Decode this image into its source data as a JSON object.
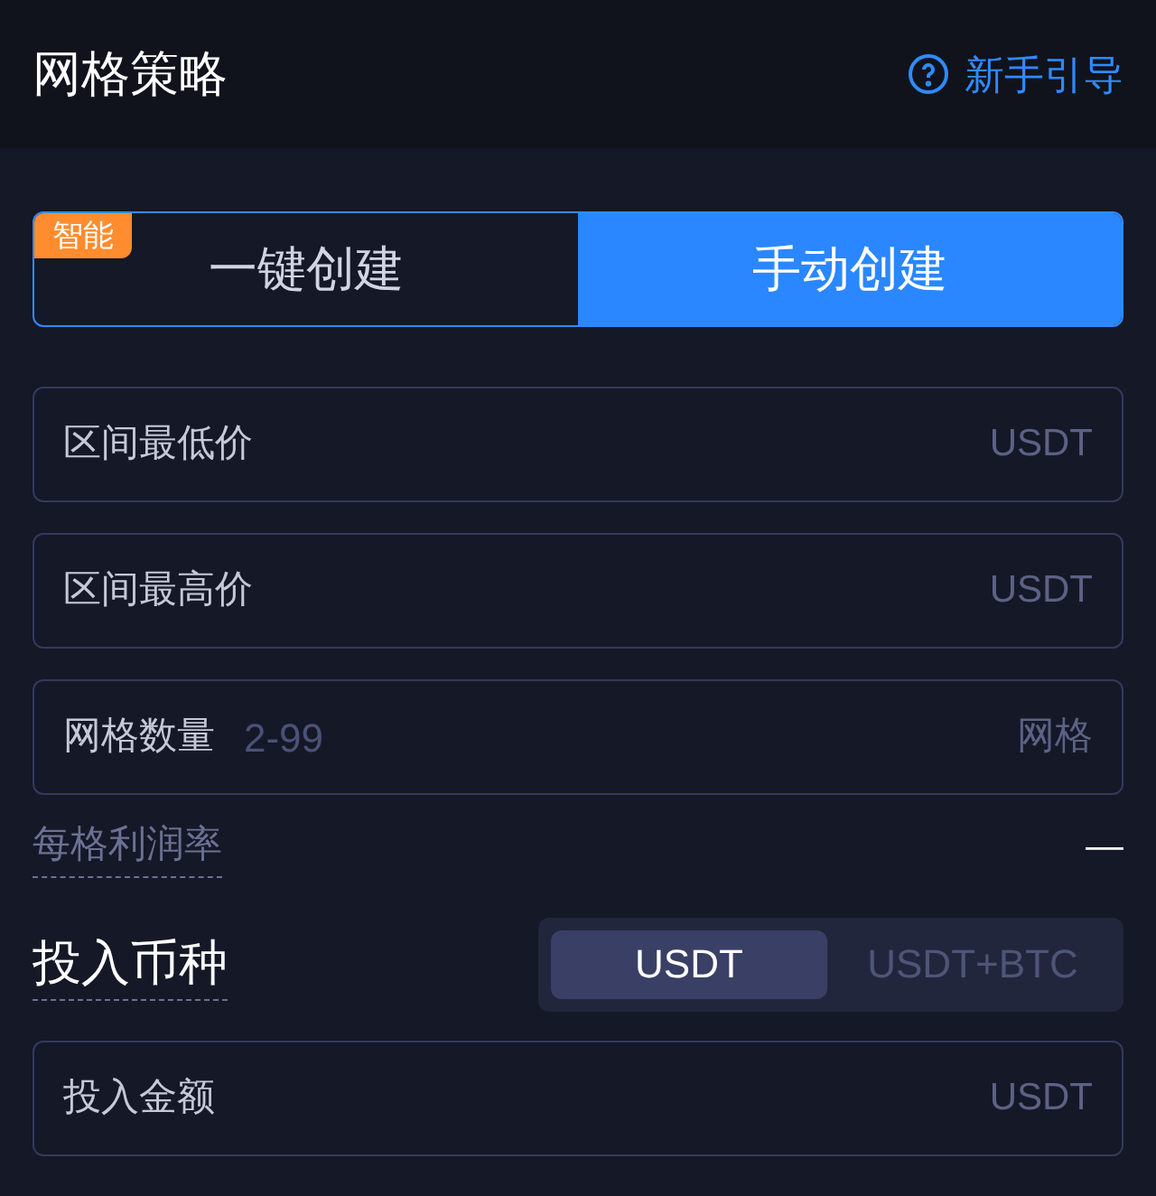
{
  "header": {
    "title": "网格策略",
    "guide_link": "新手引导"
  },
  "mode_tabs": [
    {
      "label": "一键创建",
      "badge": "智能",
      "selected": false
    },
    {
      "label": "手动创建",
      "selected": true
    }
  ],
  "fields": [
    {
      "label": "区间最低价",
      "unit": "USDT"
    },
    {
      "label": "区间最高价",
      "unit": "USDT"
    },
    {
      "label": "网格数量",
      "placeholder": "2-99",
      "unit": "网格"
    }
  ],
  "profit_rate": {
    "label": "每格利润率",
    "value": "—"
  },
  "currency": {
    "label": "投入币种",
    "options": [
      {
        "label": "USDT",
        "selected": true
      },
      {
        "label": "USDT+BTC",
        "selected": false
      }
    ]
  },
  "amount_field": {
    "label": "投入金额",
    "unit": "USDT"
  }
}
